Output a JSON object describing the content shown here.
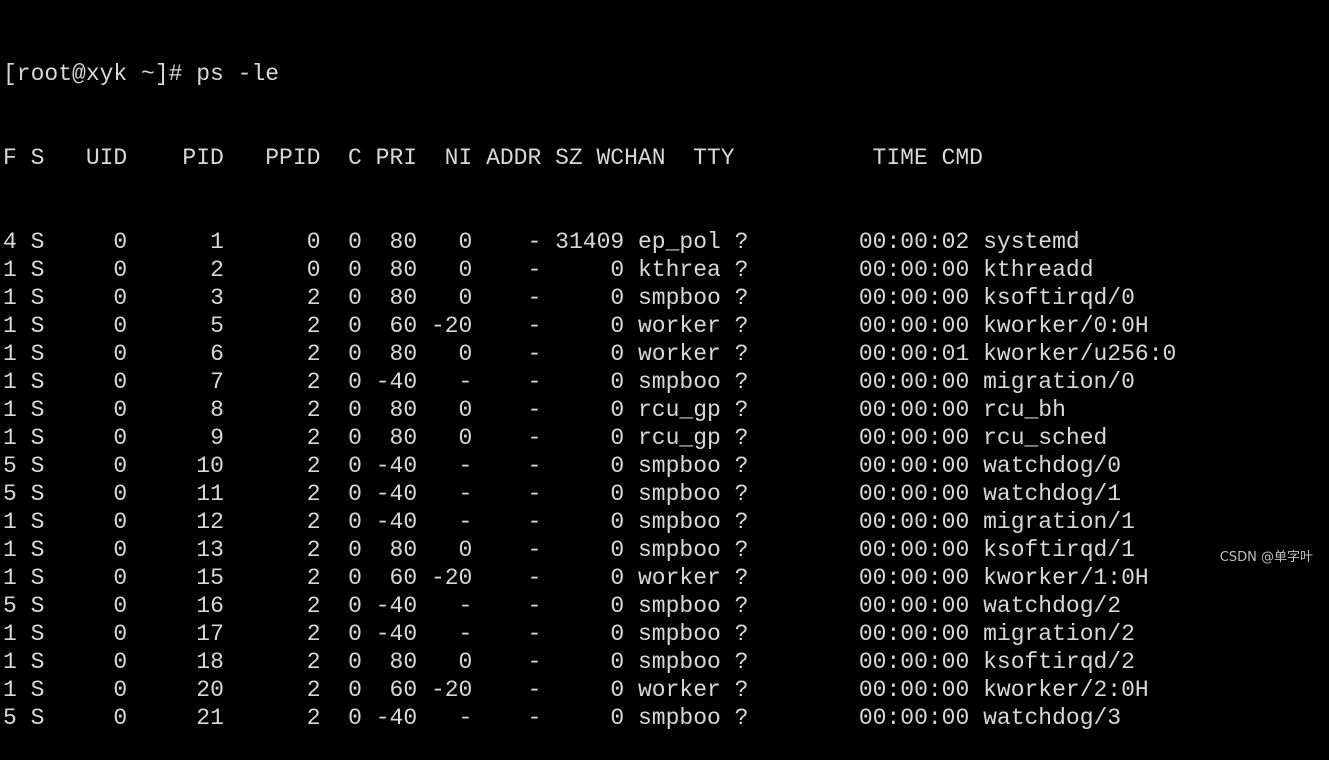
{
  "prompt": {
    "text": "[root@xyk ~]# ps -le"
  },
  "table": {
    "columns": [
      "F",
      "S",
      "UID",
      "PID",
      "PPID",
      "C",
      "PRI",
      "NI",
      "ADDR",
      "SZ",
      "WCHAN",
      "TTY",
      "TIME",
      "CMD"
    ],
    "header_line": "F S   UID    PID   PPID  C PRI  NI ADDR SZ WCHAN  TTY          TIME CMD",
    "rows": [
      {
        "F": "4",
        "S": "S",
        "UID": "0",
        "PID": "1",
        "PPID": "0",
        "C": "0",
        "PRI": "80",
        "NI": "0",
        "ADDR": "-",
        "SZ": "31409",
        "WCHAN": "ep_pol",
        "TTY": "?",
        "TIME": "00:00:02",
        "CMD": "systemd"
      },
      {
        "F": "1",
        "S": "S",
        "UID": "0",
        "PID": "2",
        "PPID": "0",
        "C": "0",
        "PRI": "80",
        "NI": "0",
        "ADDR": "-",
        "SZ": "0",
        "WCHAN": "kthrea",
        "TTY": "?",
        "TIME": "00:00:00",
        "CMD": "kthreadd"
      },
      {
        "F": "1",
        "S": "S",
        "UID": "0",
        "PID": "3",
        "PPID": "2",
        "C": "0",
        "PRI": "80",
        "NI": "0",
        "ADDR": "-",
        "SZ": "0",
        "WCHAN": "smpboo",
        "TTY": "?",
        "TIME": "00:00:00",
        "CMD": "ksoftirqd/0"
      },
      {
        "F": "1",
        "S": "S",
        "UID": "0",
        "PID": "5",
        "PPID": "2",
        "C": "0",
        "PRI": "60",
        "NI": "-20",
        "ADDR": "-",
        "SZ": "0",
        "WCHAN": "worker",
        "TTY": "?",
        "TIME": "00:00:00",
        "CMD": "kworker/0:0H"
      },
      {
        "F": "1",
        "S": "S",
        "UID": "0",
        "PID": "6",
        "PPID": "2",
        "C": "0",
        "PRI": "80",
        "NI": "0",
        "ADDR": "-",
        "SZ": "0",
        "WCHAN": "worker",
        "TTY": "?",
        "TIME": "00:00:01",
        "CMD": "kworker/u256:0"
      },
      {
        "F": "1",
        "S": "S",
        "UID": "0",
        "PID": "7",
        "PPID": "2",
        "C": "0",
        "PRI": "-40",
        "NI": "-",
        "ADDR": "-",
        "SZ": "0",
        "WCHAN": "smpboo",
        "TTY": "?",
        "TIME": "00:00:00",
        "CMD": "migration/0"
      },
      {
        "F": "1",
        "S": "S",
        "UID": "0",
        "PID": "8",
        "PPID": "2",
        "C": "0",
        "PRI": "80",
        "NI": "0",
        "ADDR": "-",
        "SZ": "0",
        "WCHAN": "rcu_gp",
        "TTY": "?",
        "TIME": "00:00:00",
        "CMD": "rcu_bh"
      },
      {
        "F": "1",
        "S": "S",
        "UID": "0",
        "PID": "9",
        "PPID": "2",
        "C": "0",
        "PRI": "80",
        "NI": "0",
        "ADDR": "-",
        "SZ": "0",
        "WCHAN": "rcu_gp",
        "TTY": "?",
        "TIME": "00:00:00",
        "CMD": "rcu_sched"
      },
      {
        "F": "5",
        "S": "S",
        "UID": "0",
        "PID": "10",
        "PPID": "2",
        "C": "0",
        "PRI": "-40",
        "NI": "-",
        "ADDR": "-",
        "SZ": "0",
        "WCHAN": "smpboo",
        "TTY": "?",
        "TIME": "00:00:00",
        "CMD": "watchdog/0"
      },
      {
        "F": "5",
        "S": "S",
        "UID": "0",
        "PID": "11",
        "PPID": "2",
        "C": "0",
        "PRI": "-40",
        "NI": "-",
        "ADDR": "-",
        "SZ": "0",
        "WCHAN": "smpboo",
        "TTY": "?",
        "TIME": "00:00:00",
        "CMD": "watchdog/1"
      },
      {
        "F": "1",
        "S": "S",
        "UID": "0",
        "PID": "12",
        "PPID": "2",
        "C": "0",
        "PRI": "-40",
        "NI": "-",
        "ADDR": "-",
        "SZ": "0",
        "WCHAN": "smpboo",
        "TTY": "?",
        "TIME": "00:00:00",
        "CMD": "migration/1"
      },
      {
        "F": "1",
        "S": "S",
        "UID": "0",
        "PID": "13",
        "PPID": "2",
        "C": "0",
        "PRI": "80",
        "NI": "0",
        "ADDR": "-",
        "SZ": "0",
        "WCHAN": "smpboo",
        "TTY": "?",
        "TIME": "00:00:00",
        "CMD": "ksoftirqd/1"
      },
      {
        "F": "1",
        "S": "S",
        "UID": "0",
        "PID": "15",
        "PPID": "2",
        "C": "0",
        "PRI": "60",
        "NI": "-20",
        "ADDR": "-",
        "SZ": "0",
        "WCHAN": "worker",
        "TTY": "?",
        "TIME": "00:00:00",
        "CMD": "kworker/1:0H"
      },
      {
        "F": "5",
        "S": "S",
        "UID": "0",
        "PID": "16",
        "PPID": "2",
        "C": "0",
        "PRI": "-40",
        "NI": "-",
        "ADDR": "-",
        "SZ": "0",
        "WCHAN": "smpboo",
        "TTY": "?",
        "TIME": "00:00:00",
        "CMD": "watchdog/2"
      },
      {
        "F": "1",
        "S": "S",
        "UID": "0",
        "PID": "17",
        "PPID": "2",
        "C": "0",
        "PRI": "-40",
        "NI": "-",
        "ADDR": "-",
        "SZ": "0",
        "WCHAN": "smpboo",
        "TTY": "?",
        "TIME": "00:00:00",
        "CMD": "migration/2"
      },
      {
        "F": "1",
        "S": "S",
        "UID": "0",
        "PID": "18",
        "PPID": "2",
        "C": "0",
        "PRI": "80",
        "NI": "0",
        "ADDR": "-",
        "SZ": "0",
        "WCHAN": "smpboo",
        "TTY": "?",
        "TIME": "00:00:00",
        "CMD": "ksoftirqd/2"
      },
      {
        "F": "1",
        "S": "S",
        "UID": "0",
        "PID": "20",
        "PPID": "2",
        "C": "0",
        "PRI": "60",
        "NI": "-20",
        "ADDR": "-",
        "SZ": "0",
        "WCHAN": "worker",
        "TTY": "?",
        "TIME": "00:00:00",
        "CMD": "kworker/2:0H"
      },
      {
        "F": "5",
        "S": "S",
        "UID": "0",
        "PID": "21",
        "PPID": "2",
        "C": "0",
        "PRI": "-40",
        "NI": "-",
        "ADDR": "-",
        "SZ": "0",
        "WCHAN": "smpboo",
        "TTY": "?",
        "TIME": "00:00:00",
        "CMD": "watchdog/3"
      }
    ]
  },
  "watermark": {
    "text": "CSDN @单字叶"
  },
  "colors": {
    "background": "#000000",
    "foreground": "#d8d8d8"
  }
}
